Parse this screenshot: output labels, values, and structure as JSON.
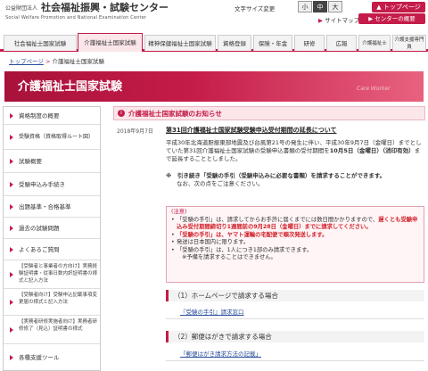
{
  "header": {
    "org_type": "公益財団法人",
    "org_name": "社会福祉振興・試験センター",
    "org_en": "Social Welfare Promotion and National Examination Center",
    "font_size_label": "文字サイズ変更",
    "font_sizes": [
      "小",
      "中",
      "大"
    ],
    "top_page_button": "▲ トップページ",
    "sitemap": "サイトマップ",
    "sitemap_arrow": "▶",
    "center_search_button": "▶ センターの概要"
  },
  "nav": {
    "tabs": [
      {
        "label": "社会福祉士国家試験"
      },
      {
        "label": "介護福祉士国家試験"
      },
      {
        "label": "精神保健福祉士国家試験"
      },
      {
        "label": "資格登録"
      },
      {
        "label": "保険・年金"
      },
      {
        "label": "研修"
      },
      {
        "label": "広報"
      },
      {
        "label": "介護福祉士"
      },
      {
        "label": "介護支援専門員"
      }
    ]
  },
  "breadcrumb": {
    "home": "トップページ",
    "sep": ">",
    "current": "介護福祉士国家試験"
  },
  "banner": {
    "title": "介護福祉士国家試験",
    "subtitle": "Care Worker"
  },
  "sidebar": {
    "items": [
      {
        "label": "資格制度の概要"
      },
      {
        "label": "受験資格（資格取得ルート図）"
      },
      {
        "label": "試験概要"
      },
      {
        "label": "受験申込み手続き"
      },
      {
        "label": "出題基準・合格基準"
      },
      {
        "label": "過去の試験問題"
      },
      {
        "label": "よくあるご質問"
      },
      {
        "label": "【受験者と事業者の方向け】実務経験証明書・従事日数内訳証明書の様式と記入方法"
      },
      {
        "label": "【受験者向け】受験申込記載事項変更届の様式と記入方法"
      },
      {
        "label": "【実務者研修実施者向け】実務者研修修了（見込）証明書の様式"
      },
      {
        "label": "各種支援ツール"
      }
    ]
  },
  "main": {
    "section_title": "介護福祉士国家試験のお知らせ",
    "date": "2018年9月7日",
    "notice_title": "第31回介護福祉士国家試験受験申込受付期間の延長について",
    "para1_a": "平成30年北海道胆振東部地震及び台風第21号の発生に伴い、平成30年9月7日（金曜日）までとしていた第31回介護福祉士国家試験の受験申込書類の受付期間を",
    "para1_bold": "10月5日（金曜日）（消印有効）",
    "para1_b": "まで延長することとしました。",
    "para2_a": "※　引き続き「受験の手引（受験申込みに必要な書類）を請求することができます。",
    "para2_b": "なお、次の点をご注意ください。",
    "notes_title": "(注意)",
    "note1_a": "「受験の手引」は、請求してからお手許に届くまでには数日間かかりますので、",
    "note1_red": "遅くとも受験申込み受付期間締切り1週間前の9月28日（金曜日）までに請求してください。",
    "note2_red": "「受験の手引」は、ヤマト運輸の宅配便で順次発送します。",
    "note3": "発送は日本国内に限ります。",
    "note4": "「受験の手引」は、1人につき1部のみ請求できます。",
    "note5": "※予備を請求することはできません。",
    "sec1": "（1）ホームページで請求する場合",
    "sec1_link": "『受験の手引』請求窓口",
    "sec2": "（2）郵便はがきで請求する場合",
    "sec2_link": "「郵便はがき請求方法の記載」"
  },
  "colors": {
    "accent": "#c51c4a",
    "link": "#2a4d9b",
    "warning": "#d0202a"
  },
  "icons": {
    "section_icon": "info-circle-icon",
    "arrow": "triangle-right-icon"
  }
}
